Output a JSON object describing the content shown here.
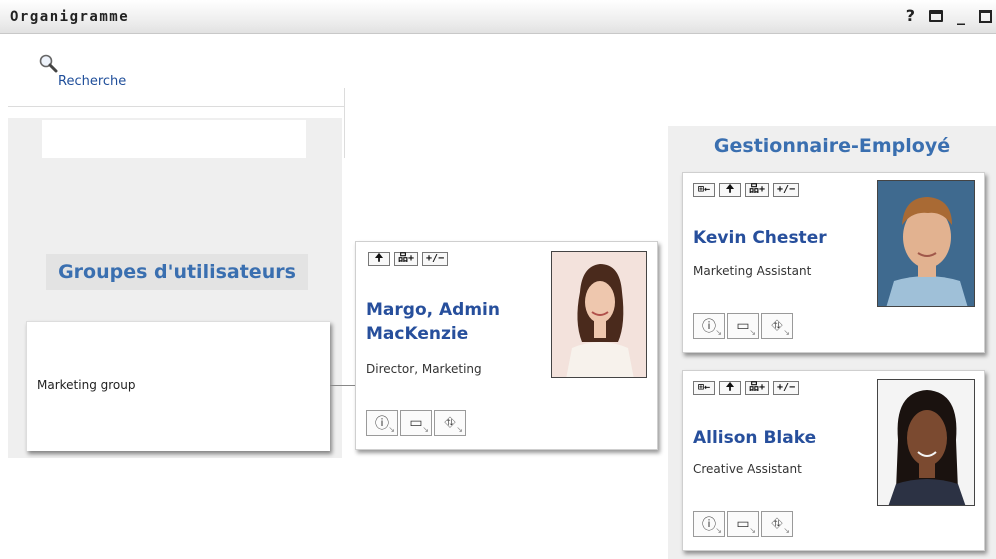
{
  "window": {
    "title": "Organigramme",
    "help_icon_label": "?",
    "minimize_label": "_"
  },
  "toolbar": {
    "search_label": "Recherche"
  },
  "groups": {
    "heading": "Groupes d'utilisateurs",
    "items": [
      {
        "label": "Marketing group"
      }
    ]
  },
  "controls": {
    "up_label": "🠉",
    "children_label": "品+",
    "toggle_label": "+/−",
    "manager_label": "⊞←"
  },
  "actions": {
    "info_icon": "info-icon",
    "vcard_icon": "vcard-icon",
    "org_icon": "org-chart-icon",
    "info_glyph": "ⓘ",
    "vcard_glyph": "▭",
    "org_glyph": "⛗"
  },
  "focus_user": {
    "name_line1": "Margo, Admin",
    "name_line2": "MacKenzie",
    "title": "Director, Marketing"
  },
  "manager_panel": {
    "heading": "Gestionnaire-Employé",
    "employees": [
      {
        "name": "Kevin Chester",
        "title": "Marketing Assistant"
      },
      {
        "name": "Allison Blake",
        "title": "Creative Assistant"
      }
    ]
  }
}
